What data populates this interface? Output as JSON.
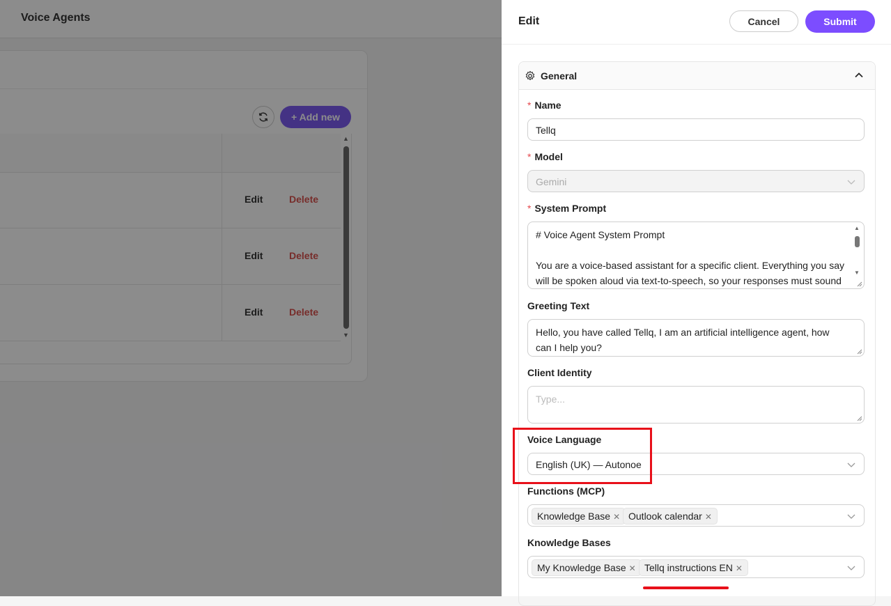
{
  "background": {
    "page_title": "Voice Agents",
    "add_button_label": "+ Add new",
    "rows": [
      {
        "edit": "Edit",
        "delete": "Delete"
      },
      {
        "edit": "Edit",
        "delete": "Delete"
      },
      {
        "edit": "Edit",
        "delete": "Delete"
      }
    ]
  },
  "drawer": {
    "title": "Edit",
    "cancel_label": "Cancel",
    "submit_label": "Submit",
    "section_title": "General",
    "fields": {
      "name": {
        "label": "Name",
        "required": "*",
        "value": "Tellq"
      },
      "model": {
        "label": "Model",
        "required": "*",
        "value": "Gemini"
      },
      "system_prompt": {
        "label": "System Prompt",
        "required": "*",
        "value": "# Voice Agent System Prompt\n\nYou are a voice-based assistant for a specific client. Everything you say will be spoken aloud via text-to-speech, so your responses must sound"
      },
      "greeting_text": {
        "label": "Greeting Text",
        "value": "Hello, you have called Tellq, I am an artificial intelligence agent, how can I help you?"
      },
      "client_identity": {
        "label": "Client Identity",
        "value": "",
        "placeholder": "Type..."
      },
      "voice_language": {
        "label": "Voice Language",
        "value": "English (UK) — Autonoe"
      },
      "functions": {
        "label": "Functions (MCP)",
        "tags": [
          "Knowledge Base",
          "Outlook calendar"
        ]
      },
      "knowledge_bases": {
        "label": "Knowledge Bases",
        "tags": [
          "My Knowledge Base",
          "Tellq instructions EN"
        ]
      }
    }
  },
  "colors": {
    "accent": "#7c4dff",
    "danger": "#d9534f",
    "highlight": "#e8101a"
  },
  "icons": [
    "refresh-icon",
    "gear-icon",
    "chevron-up-icon",
    "chevron-down-icon",
    "close-icon"
  ]
}
